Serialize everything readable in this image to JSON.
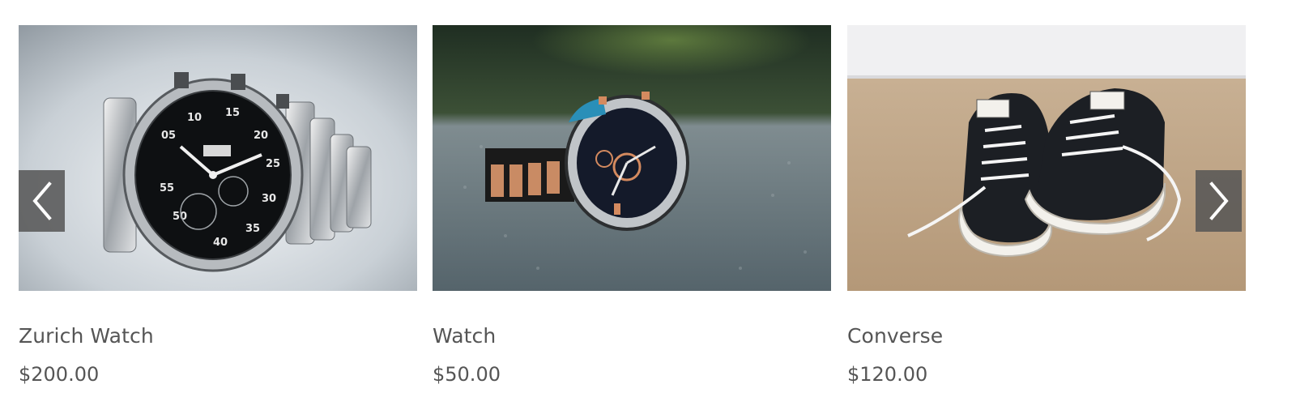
{
  "products": [
    {
      "name": "Zurich Watch",
      "price": "$200.00",
      "image_icon": "wristwatch-image"
    },
    {
      "name": "Watch",
      "price": "$50.00",
      "image_icon": "wristwatch-image"
    },
    {
      "name": "Converse",
      "price": "$120.00",
      "image_icon": "sneakers-image"
    }
  ],
  "navigation": {
    "prev_icon": "chevron-left-icon",
    "next_icon": "chevron-right-icon"
  },
  "colors": {
    "text": "#555555",
    "nav_button_bg": "#555555",
    "background": "#ffffff"
  }
}
